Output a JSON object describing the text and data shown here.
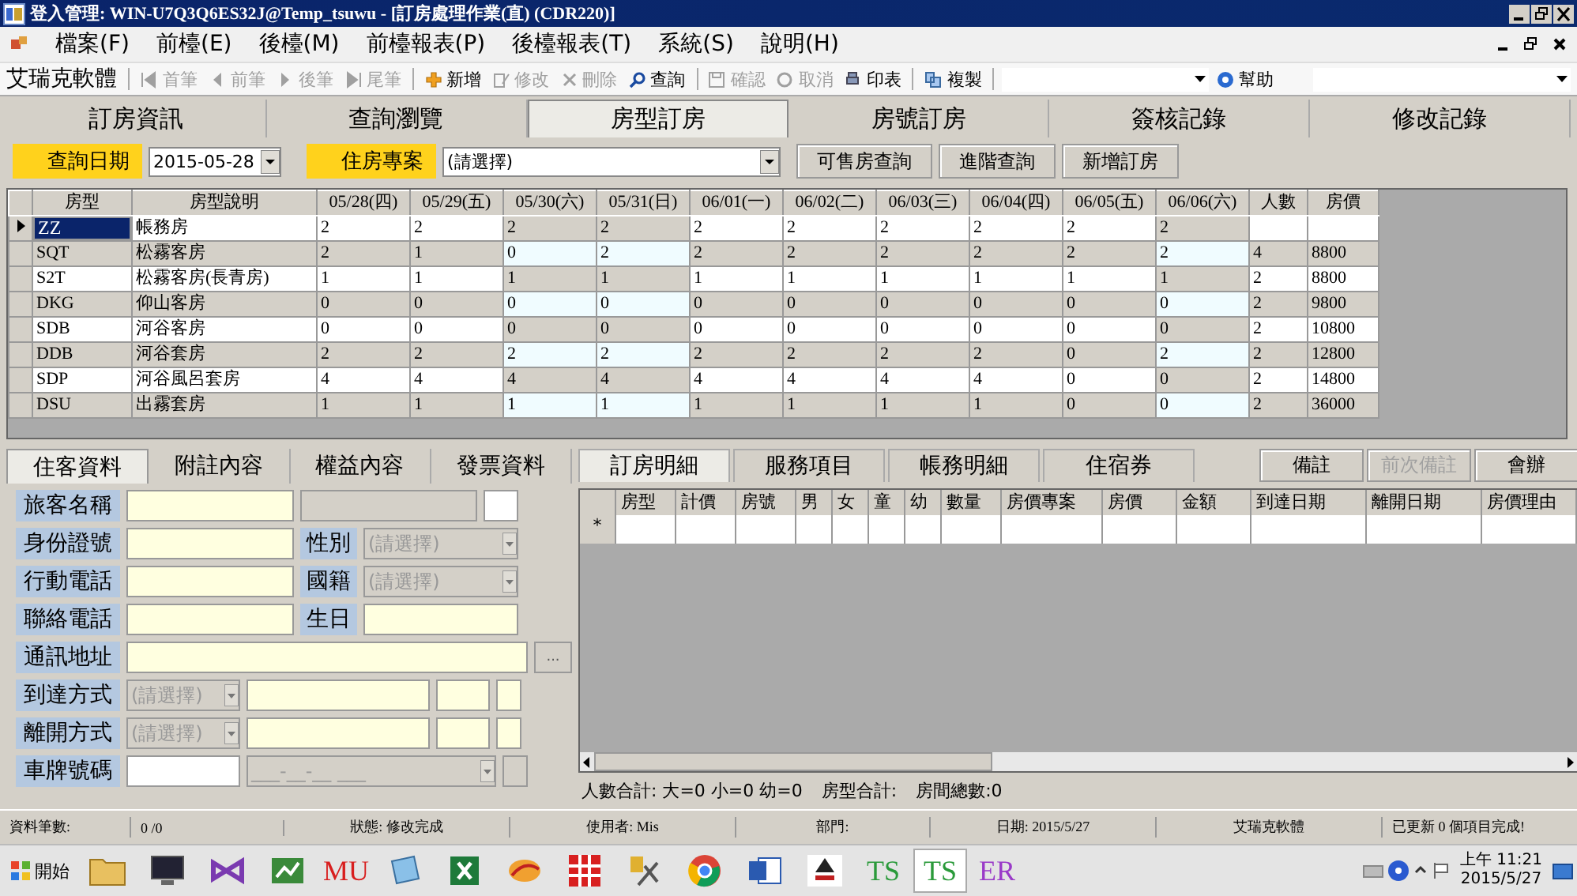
{
  "window": {
    "title": "登入管理: WIN-U7Q3Q6ES32J@Temp_tsuwu - [訂房處理作業(直) (CDR220)]"
  },
  "menu": [
    "檔案(F)",
    "前檯(E)",
    "後檯(M)",
    "前檯報表(P)",
    "後檯報表(T)",
    "系統(S)",
    "說明(H)"
  ],
  "toolbar": {
    "brand": "艾瑞克軟體",
    "buttons": [
      {
        "label": "首筆",
        "kind": "first",
        "disabled": true
      },
      {
        "label": "前筆",
        "kind": "prev",
        "disabled": true
      },
      {
        "label": "後筆",
        "kind": "next",
        "disabled": true
      },
      {
        "label": "尾筆",
        "kind": "last",
        "disabled": true
      },
      {
        "label": "新增",
        "kind": "add",
        "disabled": false
      },
      {
        "label": "修改",
        "kind": "edit",
        "disabled": true
      },
      {
        "label": "刪除",
        "kind": "delete",
        "disabled": true
      },
      {
        "label": "查詢",
        "kind": "search",
        "disabled": false
      },
      {
        "label": "確認",
        "kind": "save",
        "disabled": true
      },
      {
        "label": "取消",
        "kind": "cancel",
        "disabled": true
      },
      {
        "label": "印表",
        "kind": "print",
        "disabled": false
      },
      {
        "label": "複製",
        "kind": "copy",
        "disabled": false
      }
    ],
    "help": "幫助"
  },
  "tabs": [
    {
      "label": "訂房資訊",
      "selected": false
    },
    {
      "label": "查詢瀏覽",
      "selected": false
    },
    {
      "label": "房型訂房",
      "selected": true
    },
    {
      "label": "房號訂房",
      "selected": false
    },
    {
      "label": "簽核記錄",
      "selected": false
    },
    {
      "label": "修改記錄",
      "selected": false
    }
  ],
  "filter": {
    "date_label": "查詢日期",
    "date_value": "2015-05-28",
    "plan_label": "住房專案",
    "plan_value": "(請選擇)",
    "buttons": [
      "可售房查詢",
      "進階查詢",
      "新增訂房"
    ]
  },
  "grid": {
    "code_header": "房型",
    "name_header": "房型說明",
    "people_header": "人數",
    "price_header": "房價",
    "columns": [
      {
        "label": "05/28(四)",
        "weekend": false
      },
      {
        "label": "05/29(五)",
        "weekend": false
      },
      {
        "label": "05/30(六)",
        "weekend": true
      },
      {
        "label": "05/31(日)",
        "weekend": true
      },
      {
        "label": "06/01(一)",
        "weekend": false
      },
      {
        "label": "06/02(二)",
        "weekend": false
      },
      {
        "label": "06/03(三)",
        "weekend": false
      },
      {
        "label": "06/04(四)",
        "weekend": false
      },
      {
        "label": "06/05(五)",
        "weekend": false
      },
      {
        "label": "06/06(六)",
        "weekend": true
      }
    ],
    "rows": [
      {
        "code": "ZZ",
        "name": "帳務房",
        "values": [
          "2",
          "2",
          "2",
          "2",
          "2",
          "2",
          "2",
          "2",
          "2",
          "2"
        ],
        "selected": true
      },
      {
        "code": "SQT",
        "name": "松霧客房",
        "values": [
          "2",
          "1",
          "0",
          "2",
          "2",
          "2",
          "2",
          "2",
          "2",
          "2"
        ],
        "people": "4",
        "price": "8800",
        "selected": false
      },
      {
        "code": "S2T",
        "name": "松霧客房(長青房)",
        "values": [
          "1",
          "1",
          "1",
          "1",
          "1",
          "1",
          "1",
          "1",
          "1",
          "1"
        ],
        "people": "2",
        "price": "8800",
        "selected": false
      },
      {
        "code": "DKG",
        "name": "仰山客房",
        "values": [
          "0",
          "0",
          "0",
          "0",
          "0",
          "0",
          "0",
          "0",
          "0",
          "0"
        ],
        "people": "2",
        "price": "9800",
        "selected": false
      },
      {
        "code": "SDB",
        "name": "河谷客房",
        "values": [
          "0",
          "0",
          "0",
          "0",
          "0",
          "0",
          "0",
          "0",
          "0",
          "0"
        ],
        "people": "2",
        "price": "10800",
        "selected": false
      },
      {
        "code": "DDB",
        "name": "河谷套房",
        "values": [
          "2",
          "2",
          "2",
          "2",
          "2",
          "2",
          "2",
          "2",
          "0",
          "2"
        ],
        "people": "2",
        "price": "12800",
        "selected": false
      },
      {
        "code": "SDP",
        "name": "河谷風呂套房",
        "values": [
          "4",
          "4",
          "4",
          "4",
          "4",
          "4",
          "4",
          "4",
          "0",
          "0"
        ],
        "people": "2",
        "price": "14800",
        "selected": false
      },
      {
        "code": "DSU",
        "name": "出霧套房",
        "values": [
          "1",
          "1",
          "1",
          "1",
          "1",
          "1",
          "1",
          "1",
          "0",
          "0"
        ],
        "people": "2",
        "price": "36000",
        "selected": false
      }
    ]
  },
  "guest_tabs": [
    {
      "label": "住客資料",
      "selected": true
    },
    {
      "label": "附註內容",
      "selected": false
    },
    {
      "label": "權益內容",
      "selected": false
    },
    {
      "label": "發票資料",
      "selected": false
    }
  ],
  "form": {
    "name_label": "旅客名稱",
    "id_label": "身份證號",
    "gender_label": "性別",
    "gender_value": "(請選擇)",
    "mobile_label": "行動電話",
    "nationality_label": "國籍",
    "nationality_value": "(請選擇)",
    "phone_label": "聯絡電話",
    "birthday_label": "生日",
    "address_label": "通訊地址",
    "address_button": "...",
    "arrival_label": "到達方式",
    "arrival_value": "(請選擇)",
    "departure_label": "離開方式",
    "departure_value": "(請選擇)",
    "plate_label": "車牌號碼",
    "plate_mask": "___-__-__ ___"
  },
  "detail_tabs": [
    {
      "label": "訂房明細",
      "selected": true
    },
    {
      "label": "服務項目",
      "selected": false
    },
    {
      "label": "帳務明細",
      "selected": false
    },
    {
      "label": "住宿券",
      "selected": false
    }
  ],
  "detail_buttons": [
    {
      "label": "備註",
      "disabled": false
    },
    {
      "label": "前次備註",
      "disabled": true
    },
    {
      "label": "會辦",
      "disabled": false
    }
  ],
  "detail_grid": {
    "columns": [
      "房型",
      "計價",
      "房號",
      "男",
      "女",
      "童",
      "幼",
      "數量",
      "房價專案",
      "房價",
      "金額",
      "到達日期",
      "離開日期",
      "房價理由"
    ],
    "new_row_marker": "*"
  },
  "summary": [
    "人數合計: 大=0 小=0 幼=0",
    "房型合計:",
    "房間總數:0"
  ],
  "status_bar": [
    "資料筆數:",
    "0 /0",
    "狀態: 修改完成",
    "使用者: Mis",
    "部門:",
    "日期: 2015/5/27",
    "艾瑞克軟體",
    "已更新 0 個項目完成!"
  ],
  "taskbar": {
    "start": "開始",
    "apps": [
      {
        "kind": "folder",
        "selected": false
      },
      {
        "kind": "monitor",
        "selected": false
      },
      {
        "kind": "studio",
        "selected": false
      },
      {
        "kind": "chart",
        "selected": false
      },
      {
        "kind": "text",
        "label": "MU",
        "color": "#d81e1e",
        "selected": false
      },
      {
        "kind": "notebook",
        "selected": false
      },
      {
        "kind": "sheet",
        "selected": false
      },
      {
        "kind": "logo",
        "selected": false
      },
      {
        "kind": "grid",
        "selected": false
      },
      {
        "kind": "tools",
        "selected": false
      },
      {
        "kind": "browser",
        "selected": false
      },
      {
        "kind": "doc",
        "selected": false
      },
      {
        "kind": "emblem",
        "selected": false
      },
      {
        "kind": "text",
        "label": "TS",
        "color": "#2a9a3a",
        "selected": false
      },
      {
        "kind": "text",
        "label": "TS",
        "color": "#2a9a3a",
        "selected": true
      },
      {
        "kind": "text",
        "label": "ER",
        "color": "#9a3ac8",
        "selected": false
      }
    ],
    "time": "上午 11:21",
    "date": "2015/5/27"
  }
}
